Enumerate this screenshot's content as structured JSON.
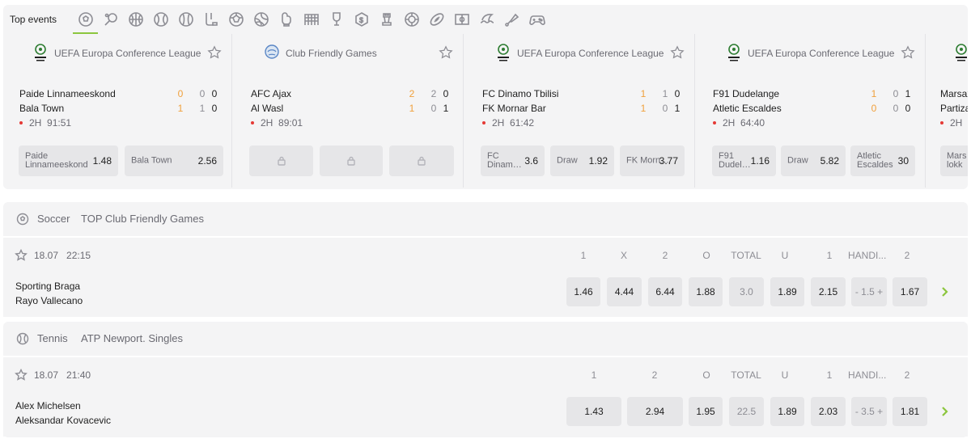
{
  "topbar": {
    "title": "Top events",
    "sports": [
      "soccer-icon",
      "table-tennis-icon",
      "basketball-icon",
      "tennis-icon",
      "baseball-icon",
      "ice-hockey-icon",
      "futsal-icon",
      "volleyball-icon",
      "boxing-icon",
      "handball-icon",
      "cricket-icon",
      "esports-icon",
      "chess-icon",
      "water-polo-icon",
      "american-football-icon",
      "field-hockey-icon",
      "surfing-icon",
      "badminton-icon",
      "gamepad-icon"
    ]
  },
  "cards": [
    {
      "league": "UEFA Europa Conference League",
      "team1": "Paide Linnameeskond",
      "team2": "Bala Town",
      "s1": [
        "0",
        "0",
        "0"
      ],
      "s2": [
        "1",
        "1",
        "0"
      ],
      "period": "2H",
      "time": "91:51",
      "odds": [
        {
          "label": "Paide Linnameeskond",
          "value": "1.48"
        },
        {
          "label": "Bala Town",
          "value": "2.56"
        }
      ]
    },
    {
      "league": "Club Friendly Games",
      "team1": "AFC Ajax",
      "team2": "Al Wasl",
      "s1": [
        "2",
        "2",
        "0"
      ],
      "s2": [
        "1",
        "0",
        "1"
      ],
      "period": "2H",
      "time": "89:01",
      "locked": true
    },
    {
      "league": "UEFA Europa Conference League",
      "team1": "FC Dinamo Tbilisi",
      "team2": "FK Mornar Bar",
      "s1": [
        "1",
        "1",
        "0"
      ],
      "s2": [
        "1",
        "0",
        "1"
      ],
      "period": "2H",
      "time": "61:42",
      "odds": [
        {
          "label": "FC Dinam…",
          "value": "3.6"
        },
        {
          "label": "Draw",
          "value": "1.92"
        },
        {
          "label": "FK Morn…",
          "value": "3.77"
        }
      ]
    },
    {
      "league": "UEFA Europa Conference League",
      "team1": "F91 Dudelange",
      "team2": "Atletic Escaldes",
      "s1": [
        "1",
        "0",
        "1"
      ],
      "s2": [
        "0",
        "0",
        "0"
      ],
      "period": "2H",
      "time": "64:40",
      "odds": [
        {
          "label": "F91 Dudel…",
          "value": "1.16"
        },
        {
          "label": "Draw",
          "value": "5.82"
        },
        {
          "label": "Atletic Escaldes",
          "value": "30"
        }
      ]
    },
    {
      "league": "",
      "team1": "Marsax",
      "team2": "Partiza",
      "period": "2H",
      "time": "",
      "odds": [
        {
          "label": "Mars lokk",
          "value": ""
        }
      ]
    }
  ],
  "sections": [
    {
      "sport": "Soccer",
      "league": "TOP Club Friendly Games",
      "date": "18.07",
      "time": "22:15",
      "team1": "Sporting Braga",
      "team2": "Rayo Vallecano",
      "headers": [
        "1",
        "X",
        "2",
        "O",
        "TOTAL",
        "U",
        "1",
        "HANDI...",
        "2"
      ],
      "cells": [
        "1.46",
        "4.44",
        "6.44",
        "1.88",
        "3.0",
        "1.89",
        "2.15",
        "- 1.5 +",
        "1.67"
      ]
    },
    {
      "sport": "Tennis",
      "league": "ATP Newport. Singles",
      "date": "18.07",
      "time": "21:40",
      "team1": "Alex Michelsen",
      "team2": "Aleksandar Kovacevic",
      "headers": [
        "1",
        "2",
        "O",
        "TOTAL",
        "U",
        "1",
        "HANDI...",
        "2"
      ],
      "cells": [
        "1.43",
        "2.94",
        "1.95",
        "22.5",
        "1.89",
        "2.03",
        "- 3.5 +",
        "1.81"
      ]
    }
  ]
}
